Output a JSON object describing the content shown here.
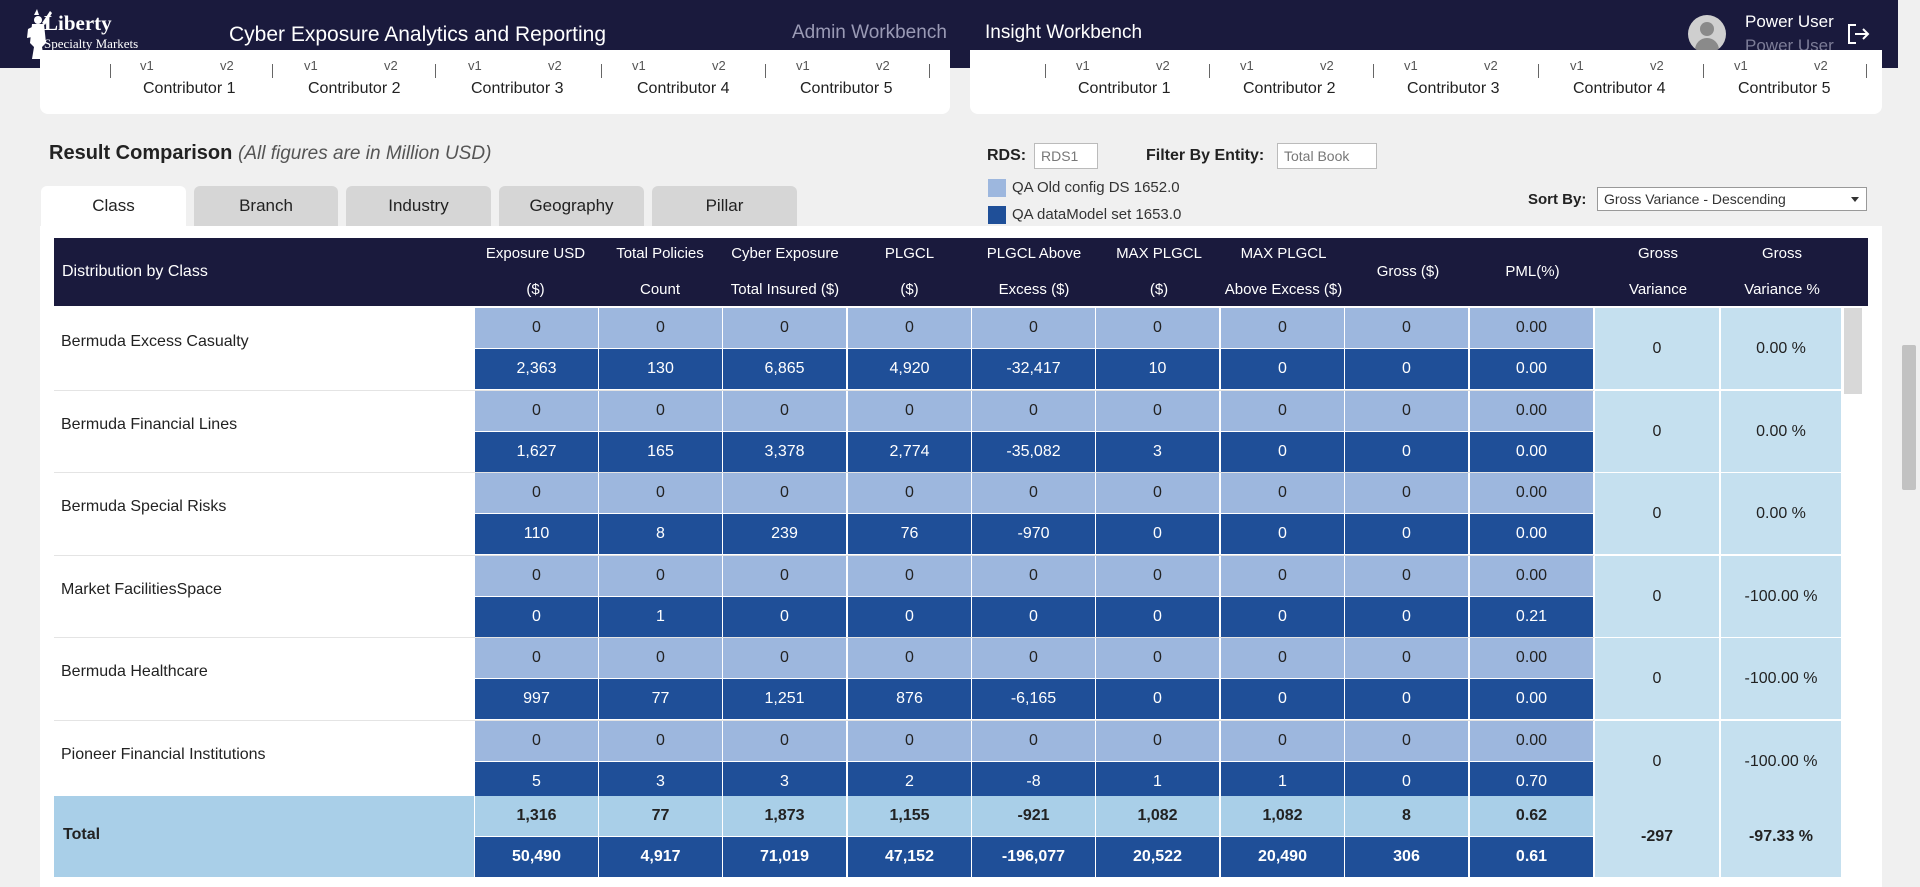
{
  "header": {
    "logo_line1": "Liberty",
    "logo_line2": "Specialty Markets",
    "app_title": "Cyber Exposure Analytics and Reporting",
    "nav": [
      {
        "label": "Admin Workbench",
        "active": false
      },
      {
        "label": "Insight Workbench",
        "active": true
      }
    ],
    "user_name": "Power User",
    "user_role": "Power User"
  },
  "contributors": {
    "left": [
      "Contributor 1",
      "Contributor 2",
      "Contributor 3",
      "Contributor 4",
      "Contributor 5"
    ],
    "right": [
      "Contributor 1",
      "Contributor 2",
      "Contributor 3",
      "Contributor 4",
      "Contributor 5"
    ],
    "v1_label": "v1",
    "v2_label": "v2"
  },
  "section": {
    "title": "Result Comparison",
    "subtitle": "(All figures are in Million USD)"
  },
  "filters": {
    "rds_label": "RDS:",
    "rds_value": "RDS1",
    "entity_label": "Filter By Entity:",
    "entity_value": "Total Book",
    "sort_label": "Sort By:",
    "sort_value": "Gross Variance - Descending"
  },
  "legend": [
    {
      "label": "QA Old config DS 1652.0",
      "color": "#9db7de"
    },
    {
      "label": "QA dataModel set 1653.0",
      "color": "#1f4f98"
    }
  ],
  "tabs": [
    {
      "label": "Class",
      "active": true
    },
    {
      "label": "Branch",
      "active": false
    },
    {
      "label": "Industry",
      "active": false
    },
    {
      "label": "Geography",
      "active": false
    },
    {
      "label": "Pillar",
      "active": false
    }
  ],
  "table": {
    "first_header": "Distribution by Class",
    "columns": [
      [
        "Exposure USD",
        "($)"
      ],
      [
        "Total Policies",
        "Count"
      ],
      [
        "Cyber Exposure",
        "Total Insured ($)"
      ],
      [
        "PLGCL",
        "($)"
      ],
      [
        "PLGCL Above",
        "Excess ($)"
      ],
      [
        "MAX PLGCL",
        "($)"
      ],
      [
        "MAX PLGCL",
        "Above Excess ($)"
      ],
      [
        "Gross ($)"
      ],
      [
        "PML(%)"
      ],
      [
        "Gross",
        "Variance"
      ],
      [
        "Gross",
        "Variance %"
      ]
    ],
    "rows": [
      {
        "label": "Bermuda Excess Casualty",
        "old": [
          "0",
          "0",
          "0",
          "0",
          "0",
          "0",
          "0",
          "0",
          "0.00"
        ],
        "new": [
          "2,363",
          "130",
          "6,865",
          "4,920",
          "-32,417",
          "10",
          "0",
          "0",
          "0.00"
        ],
        "gross_variance": "0",
        "gross_variance_pct": "0.00 %"
      },
      {
        "label": "Bermuda Financial Lines",
        "old": [
          "0",
          "0",
          "0",
          "0",
          "0",
          "0",
          "0",
          "0",
          "0.00"
        ],
        "new": [
          "1,627",
          "165",
          "3,378",
          "2,774",
          "-35,082",
          "3",
          "0",
          "0",
          "0.00"
        ],
        "gross_variance": "0",
        "gross_variance_pct": "0.00 %"
      },
      {
        "label": "Bermuda Special Risks",
        "old": [
          "0",
          "0",
          "0",
          "0",
          "0",
          "0",
          "0",
          "0",
          "0.00"
        ],
        "new": [
          "110",
          "8",
          "239",
          "76",
          "-970",
          "0",
          "0",
          "0",
          "0.00"
        ],
        "gross_variance": "0",
        "gross_variance_pct": "0.00 %"
      },
      {
        "label": "Market FacilitiesSpace",
        "old": [
          "0",
          "0",
          "0",
          "0",
          "0",
          "0",
          "0",
          "0",
          "0.00"
        ],
        "new": [
          "0",
          "1",
          "0",
          "0",
          "0",
          "0",
          "0",
          "0",
          "0.21"
        ],
        "gross_variance": "0",
        "gross_variance_pct": "-100.00 %"
      },
      {
        "label": "Bermuda Healthcare",
        "old": [
          "0",
          "0",
          "0",
          "0",
          "0",
          "0",
          "0",
          "0",
          "0.00"
        ],
        "new": [
          "997",
          "77",
          "1,251",
          "876",
          "-6,165",
          "0",
          "0",
          "0",
          "0.00"
        ],
        "gross_variance": "0",
        "gross_variance_pct": "-100.00 %"
      },
      {
        "label": "Pioneer Financial Institutions",
        "old": [
          "0",
          "0",
          "0",
          "0",
          "0",
          "0",
          "0",
          "0",
          "0.00"
        ],
        "new": [
          "5",
          "3",
          "3",
          "2",
          "-8",
          "1",
          "1",
          "0",
          "0.70"
        ],
        "gross_variance": "0",
        "gross_variance_pct": "-100.00 %"
      }
    ],
    "total": {
      "label": "Total",
      "old": [
        "1,316",
        "77",
        "1,873",
        "1,155",
        "-921",
        "1,082",
        "1,082",
        "8",
        "0.62"
      ],
      "new": [
        "50,490",
        "4,917",
        "71,019",
        "47,152",
        "-196,077",
        "20,522",
        "20,490",
        "306",
        "0.61"
      ],
      "gross_variance": "-297",
      "gross_variance_pct": "-97.33 %"
    }
  }
}
